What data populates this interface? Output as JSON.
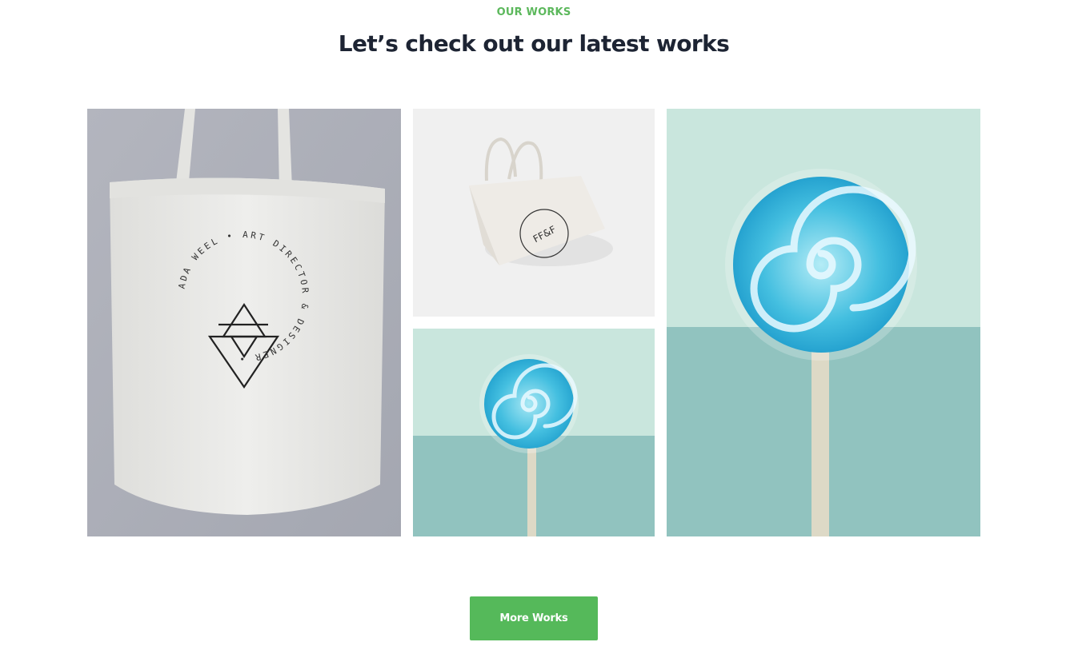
{
  "section": {
    "eyebrow": "OUR WORKS",
    "headline": "Let’s check out our latest works"
  },
  "gallery": {
    "tote_logo": {
      "ring_text": "ADA WEEL • ART DIRECTOR & DESIGNER •"
    },
    "small_tote_logo": {
      "text": "FF&F"
    }
  },
  "cta": {
    "label": "More Works"
  },
  "colors": {
    "accent": "#5cb85c",
    "headline": "#1d2433",
    "mint_light": "#c9e6dd",
    "mint_dark": "#91c3bf",
    "candy": "#2bb0d8"
  }
}
